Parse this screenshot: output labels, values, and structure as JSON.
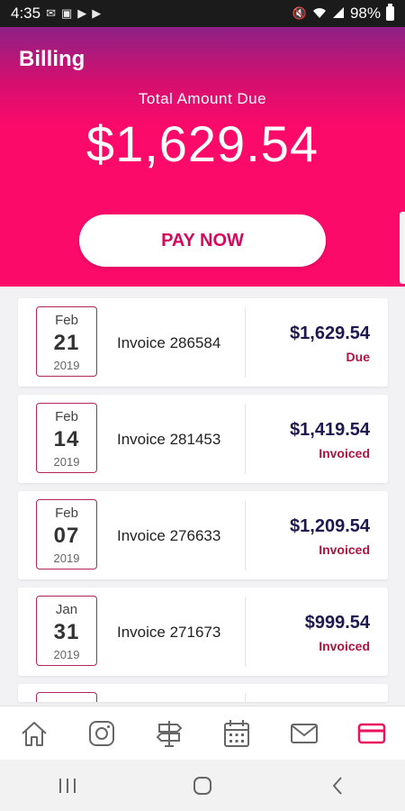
{
  "status_bar": {
    "time": "4:35",
    "battery": "98%",
    "left_icons": [
      "gmail-icon",
      "image-icon",
      "play-icon",
      "play-icon"
    ],
    "right_icons": [
      "mute-icon",
      "wifi-icon",
      "signal-icon",
      "battery-icon"
    ]
  },
  "header": {
    "title": "Billing",
    "total_label": "Total Amount Due",
    "total_amount": "$1,629.54",
    "pay_button": "PAY NOW"
  },
  "invoices": [
    {
      "month": "Feb",
      "day": "21",
      "year": "2019",
      "name": "Invoice 286584",
      "amount": "$1,629.54",
      "status": "Due"
    },
    {
      "month": "Feb",
      "day": "14",
      "year": "2019",
      "name": "Invoice 281453",
      "amount": "$1,419.54",
      "status": "Invoiced"
    },
    {
      "month": "Feb",
      "day": "07",
      "year": "2019",
      "name": "Invoice 276633",
      "amount": "$1,209.54",
      "status": "Invoiced"
    },
    {
      "month": "Jan",
      "day": "31",
      "year": "2019",
      "name": "Invoice 271673",
      "amount": "$999.54",
      "status": "Invoiced"
    }
  ],
  "bottom_nav": [
    "home-icon",
    "instagram-icon",
    "signpost-icon",
    "calendar-icon",
    "mail-icon",
    "credit-card-icon"
  ],
  "colors": {
    "accent": "#fb0a6a",
    "amount_text": "#1e1850",
    "status_text": "#b0133f"
  }
}
